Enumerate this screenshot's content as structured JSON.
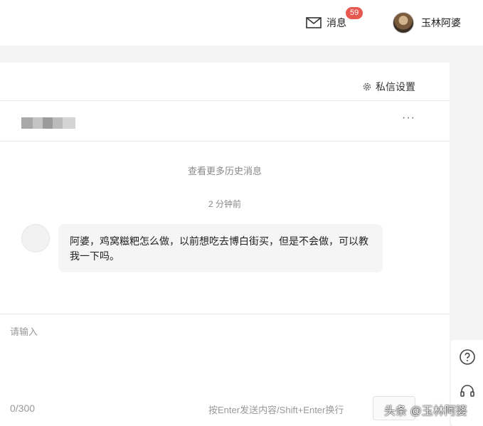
{
  "header": {
    "messages_label": "消息",
    "messages_badge": "59",
    "user_name": "玉林阿婆"
  },
  "panel": {
    "settings_label": "私信设置",
    "more_label": "···",
    "history_label": "查看更多历史消息",
    "timestamp": "2 分钟前",
    "message_text": "阿婆，鸡窝糍粑怎么做，以前想吃去博白街买，但是不会做，可以教我一下吗。"
  },
  "composer": {
    "placeholder": "请输入",
    "value": "",
    "char_count": "0/300",
    "send_hint": "按Enter发送内容/Shift+Enter换行"
  },
  "side_tools": [
    "help-icon",
    "headset-icon"
  ],
  "watermark": "头条 @玉林阿婆",
  "colors": {
    "badge": "#e7584f",
    "page_bg": "#f4f4f4",
    "bubble_bg": "#f5f5f5"
  }
}
